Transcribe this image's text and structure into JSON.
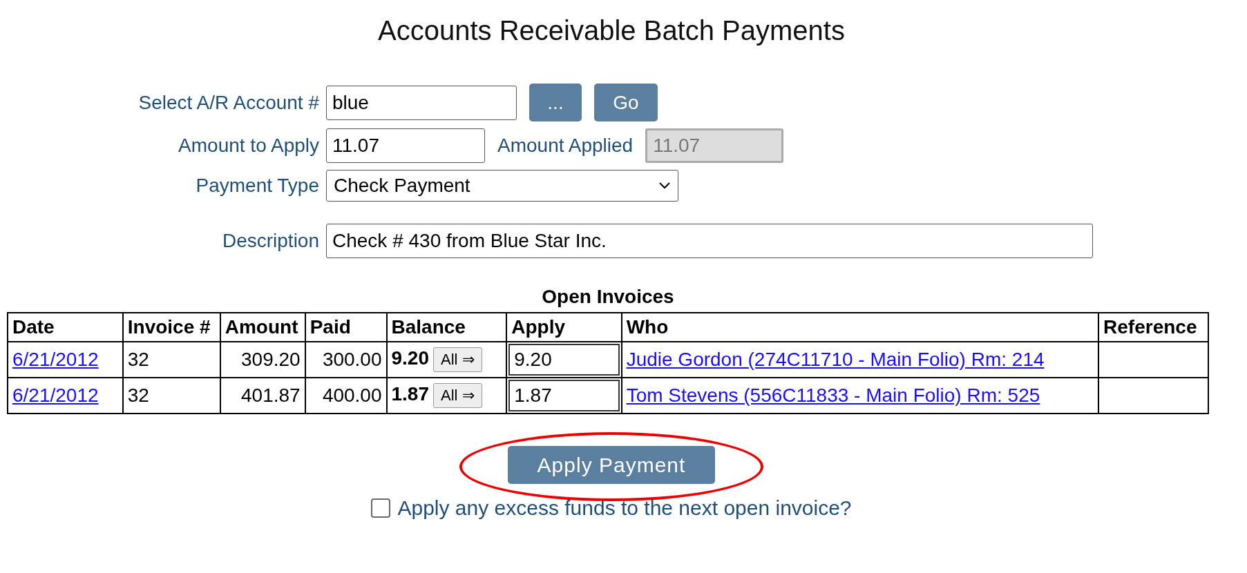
{
  "title": "Accounts Receivable Batch Payments",
  "form": {
    "account": {
      "label": "Select A/R Account #",
      "value": "blue",
      "buttons": [
        "...",
        "Go"
      ]
    },
    "amount": {
      "label": "Amount to Apply",
      "value": "11.07"
    },
    "applied": {
      "label": "Amount Applied",
      "value": "11.07",
      "disabled": true
    },
    "payment_type": {
      "label": "Payment Type",
      "value": "Check Payment"
    },
    "description": {
      "label": "Description",
      "value": "Check # 430 from Blue Star Inc."
    }
  },
  "invoices": {
    "title": "Open Invoices",
    "columns": [
      "Date",
      "Invoice #",
      "Amount",
      "Paid",
      "Balance",
      "Apply",
      "Who",
      "Reference"
    ],
    "rows": [
      {
        "date": "6/21/2012",
        "invoice": "32",
        "amount": "309.20",
        "paid": "300.00",
        "balance": "9.20",
        "all_button": "All ⇒",
        "apply": "9.20",
        "who": "Judie Gordon (274C11710 - Main Folio) Rm: 214"
      },
      {
        "date": "6/21/2012",
        "invoice": "32",
        "amount": "401.87",
        "paid": "400.00",
        "balance": "1.87",
        "all_button": "All ⇒",
        "apply": "1.87",
        "who": "Tom Stevens (556C11833 - Main Folio) Rm: 525"
      }
    ]
  },
  "apply_button": "Apply Payment",
  "excess_option": {
    "label": "Apply any excess funds to the next open invoice?",
    "checked": false
  }
}
